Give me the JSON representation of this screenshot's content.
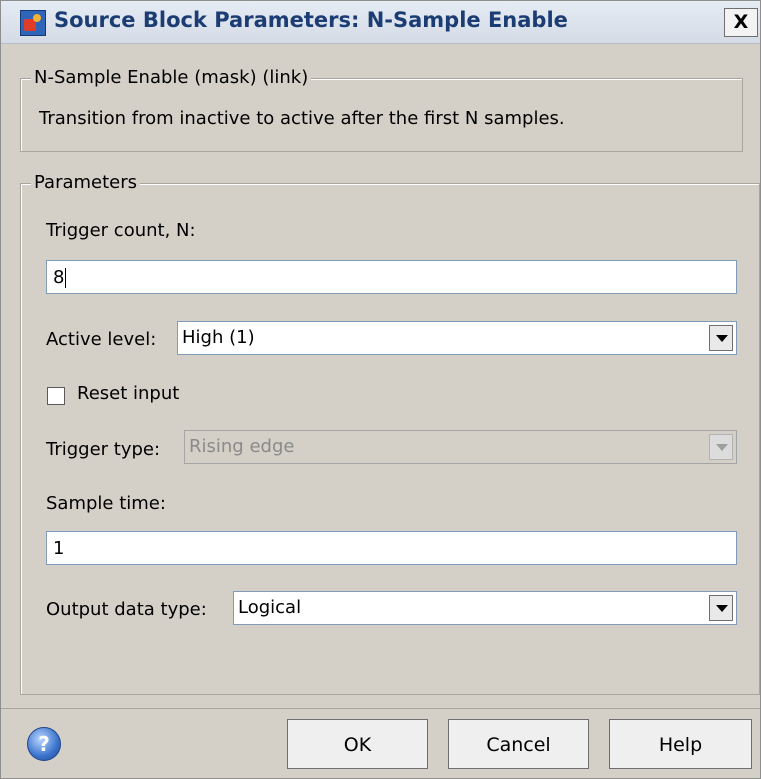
{
  "window": {
    "title": "Source Block Parameters: N-Sample Enable",
    "close_glyph": "X"
  },
  "mask": {
    "legend": "N-Sample Enable (mask) (link)",
    "description": "Transition from inactive to active after the first N samples."
  },
  "params": {
    "legend": "Parameters",
    "trigger_count_label": "Trigger count, N:",
    "trigger_count_value": "8",
    "active_level_label": "Active level:",
    "active_level_value": "High (1)",
    "reset_input_label": "Reset input",
    "reset_input_checked": false,
    "trigger_type_label": "Trigger type:",
    "trigger_type_value": "Rising edge",
    "sample_time_label": "Sample time:",
    "sample_time_value": "1",
    "output_type_label": "Output data type:",
    "output_type_value": "Logical"
  },
  "footer": {
    "help_glyph": "?",
    "ok_label": "OK",
    "cancel_label": "Cancel",
    "help_label": "Help"
  }
}
